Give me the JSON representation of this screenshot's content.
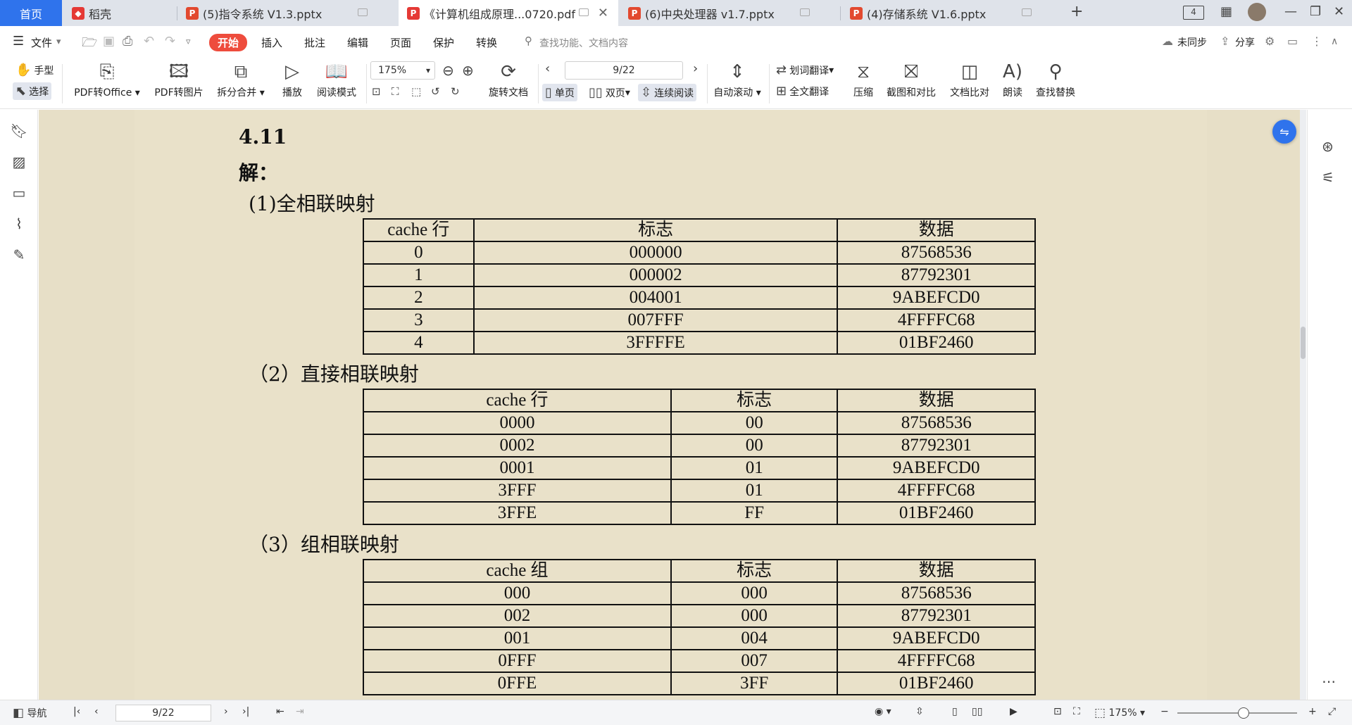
{
  "tabs": [
    {
      "label": "首页",
      "kind": "home"
    },
    {
      "label": "稻壳",
      "kind": "docer"
    },
    {
      "label": "(5)指令系统 V1.3.pptx",
      "kind": "pptx"
    },
    {
      "label": "《计算机组成原理...0720.pdf",
      "kind": "pdf",
      "active": true
    },
    {
      "label": "(6)中央处理器 v1.7.pptx",
      "kind": "pptx"
    },
    {
      "label": "(4)存储系统 V1.6.pptx",
      "kind": "pptx"
    }
  ],
  "window": {
    "badge": "4"
  },
  "menu": {
    "file": "文件",
    "items": [
      "开始",
      "插入",
      "批注",
      "编辑",
      "页面",
      "保护",
      "转换"
    ],
    "search_placeholder": "查找功能、文档内容",
    "sync": "未同步",
    "share": "分享"
  },
  "toolbar": {
    "hand": "手型",
    "select": "选择",
    "pdf_to_office": "PDF转Office",
    "pdf_to_image": "PDF转图片",
    "split_merge": "拆分合并",
    "play": "播放",
    "read_mode": "阅读模式",
    "zoom": "175%",
    "page_input": "9/22",
    "rotate": "旋转文档",
    "single": "单页",
    "double": "双页",
    "continuous": "连续阅读",
    "auto_scroll": "自动滚动",
    "word_translate": "划词翻译",
    "full_translate": "全文翻译",
    "compress": "压缩",
    "screenshot_compare": "截图和对比",
    "doc_compare": "文档比对",
    "read_aloud": "朗读",
    "find_replace": "查找替换"
  },
  "document": {
    "problem": "4.11",
    "answer": "解：",
    "sections": [
      {
        "title": "(1)全相联映射",
        "headers": [
          "cache 行",
          "标志",
          "数据"
        ],
        "rows": [
          [
            "0",
            "000000",
            "87568536"
          ],
          [
            "1",
            "000002",
            "87792301"
          ],
          [
            "2",
            "004001",
            "9ABEFCD0"
          ],
          [
            "3",
            "007FFF",
            "4FFFFC68"
          ],
          [
            "4",
            "3FFFFE",
            "01BF2460"
          ]
        ]
      },
      {
        "title": "（2）直接相联映射",
        "headers": [
          "cache 行",
          "标志",
          "数据"
        ],
        "rows": [
          [
            "0000",
            "00",
            "87568536"
          ],
          [
            "0002",
            "00",
            "87792301"
          ],
          [
            "0001",
            "01",
            "9ABEFCD0"
          ],
          [
            "3FFF",
            "01",
            "4FFFFC68"
          ],
          [
            "3FFE",
            "FF",
            "01BF2460"
          ]
        ]
      },
      {
        "title": "（3）组相联映射",
        "headers": [
          "cache 组",
          "标志",
          "数据"
        ],
        "rows": [
          [
            "000",
            "000",
            "87568536"
          ],
          [
            "002",
            "000",
            "87792301"
          ],
          [
            "001",
            "004",
            "9ABEFCD0"
          ],
          [
            "0FFF",
            "007",
            "4FFFFC68"
          ],
          [
            "0FFE",
            "3FF",
            "01BF2460"
          ]
        ]
      }
    ]
  },
  "status": {
    "nav": "导航",
    "page": "9/22",
    "zoom": "175%",
    "zoom_level": 0.55
  },
  "colors": {
    "accent": "#2f73ec",
    "start_tab": "#ee4c3d",
    "page_bg": "#e9e1c9"
  }
}
